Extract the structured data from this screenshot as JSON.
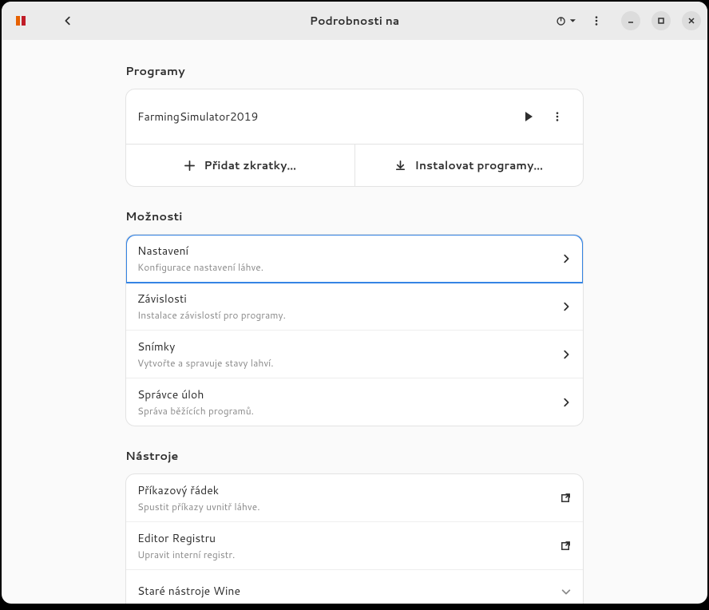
{
  "header": {
    "title": "Podrobnosti na"
  },
  "sections": {
    "programs": {
      "title": "Programy",
      "items": [
        {
          "name": "FarmingSimulator2019"
        }
      ],
      "add_shortcut": "Přidat zkratky…",
      "install_programs": "Instalovat programy…"
    },
    "options": {
      "title": "Možnosti",
      "rows": [
        {
          "title": "Nastavení",
          "sub": "Konfigurace nastavení láhve."
        },
        {
          "title": "Závislosti",
          "sub": "Instalace závislostí pro programy."
        },
        {
          "title": "Snímky",
          "sub": "Vytvořte a spravuje stavy lahví."
        },
        {
          "title": "Správce úloh",
          "sub": "Správa běžících programů."
        }
      ]
    },
    "tools": {
      "title": "Nástroje",
      "rows": [
        {
          "title": "Příkazový řádek",
          "sub": "Spustit příkazy uvnitř láhve.",
          "icon": "external"
        },
        {
          "title": "Editor Registru",
          "sub": "Upravit interní registr.",
          "icon": "external"
        },
        {
          "title": "Staré nástroje Wine",
          "sub": "",
          "icon": "expand"
        }
      ]
    }
  }
}
